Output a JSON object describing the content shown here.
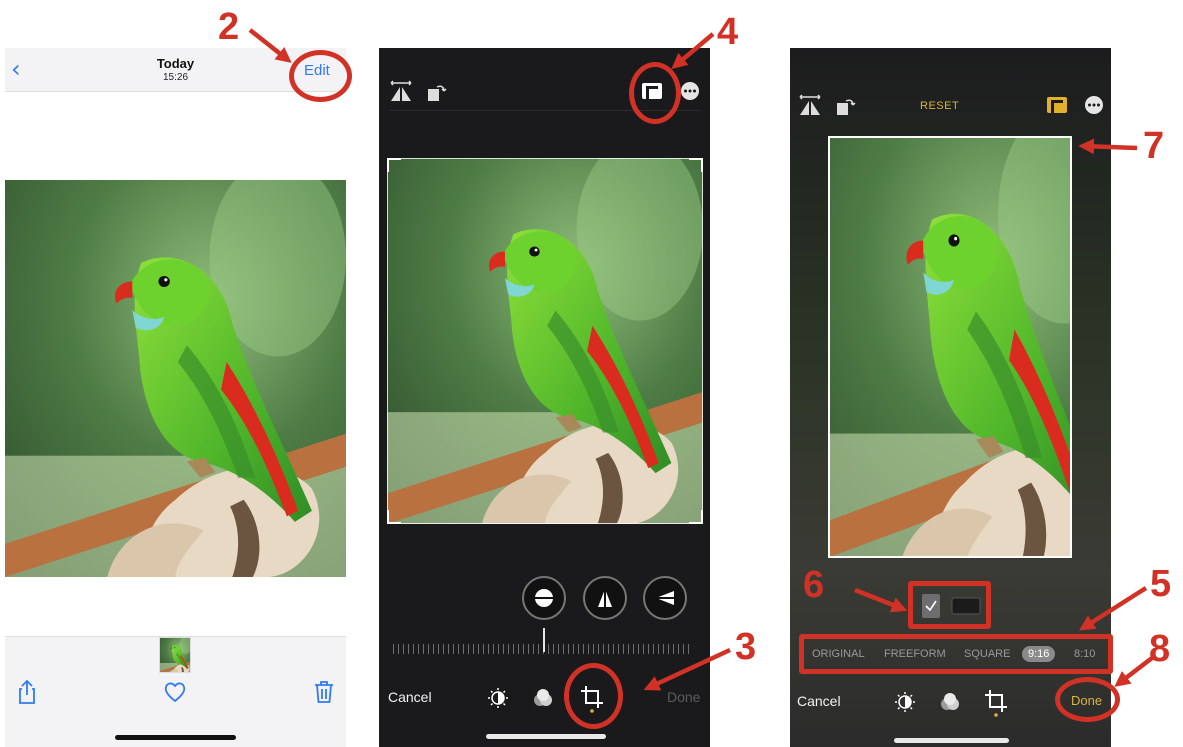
{
  "panel1": {
    "title": "Today",
    "time": "15:26",
    "edit_label": "Edit",
    "icons": [
      "back-chevron-icon",
      "share-icon",
      "heart-icon",
      "trash-icon"
    ]
  },
  "panel2": {
    "cancel_label": "Cancel",
    "done_label": "Done",
    "icons": [
      "flip-icon",
      "rotate-icon",
      "aspect-ratio-icon",
      "more-icon",
      "straighten-icon",
      "vertical-perspective-icon",
      "horizontal-perspective-icon",
      "adjust-icon",
      "filters-icon",
      "crop-icon"
    ]
  },
  "panel3": {
    "reset_label": "RESET",
    "cancel_label": "Cancel",
    "done_label": "Done",
    "aspect_options": [
      "ORIGINAL",
      "FREEFORM",
      "SQUARE",
      "9:16",
      "8:10"
    ],
    "selected_aspect": "9:16",
    "orientation_selected": "portrait"
  },
  "annotations": [
    "2",
    "3",
    "4",
    "5",
    "6",
    "7",
    "8"
  ],
  "colors": {
    "annotation_red": "#d23226",
    "ios_blue": "#2f7bf6",
    "crop_yellow": "#d9b43a"
  }
}
